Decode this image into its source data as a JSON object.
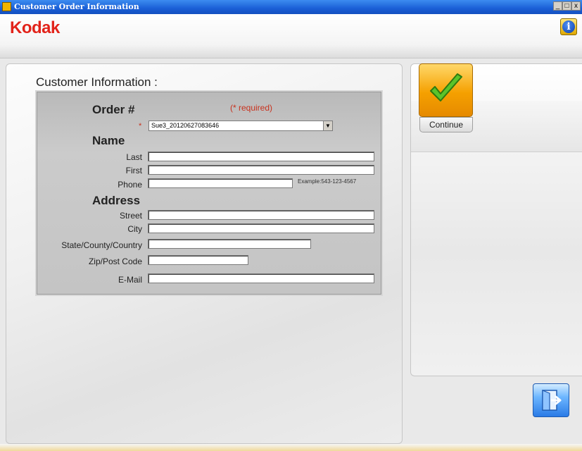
{
  "window": {
    "title": "Customer Order Information",
    "controls": [
      "_",
      "□",
      "x"
    ]
  },
  "header": {
    "logo": "Kodak",
    "info_icon": "info-icon"
  },
  "form": {
    "section_title": "Customer Information :",
    "required_note": "(* required)",
    "required_marker": "*",
    "order_label": "Order #",
    "order_value": "Sue3_20120627083646",
    "name_heading": "Name",
    "last_label": "Last",
    "first_label": "First",
    "phone_label": "Phone",
    "phone_example": "Example:543-123-4567",
    "address_heading": "Address",
    "street_label": "Street",
    "city_label": "City",
    "state_label": "State/County/Country",
    "zip_label": "Zip/Post Code",
    "email_label": "E-Mail",
    "values": {
      "last": "",
      "first": "",
      "phone": "",
      "street": "",
      "city": "",
      "state": "",
      "zip": "",
      "email": ""
    }
  },
  "actions": {
    "continue_label": "Continue",
    "exit_icon": "exit-door-icon"
  },
  "colors": {
    "brand": "#e2231a",
    "required": "#c8321e",
    "continue_bg": "#f5a000",
    "exit_bg": "#2a7be6"
  }
}
